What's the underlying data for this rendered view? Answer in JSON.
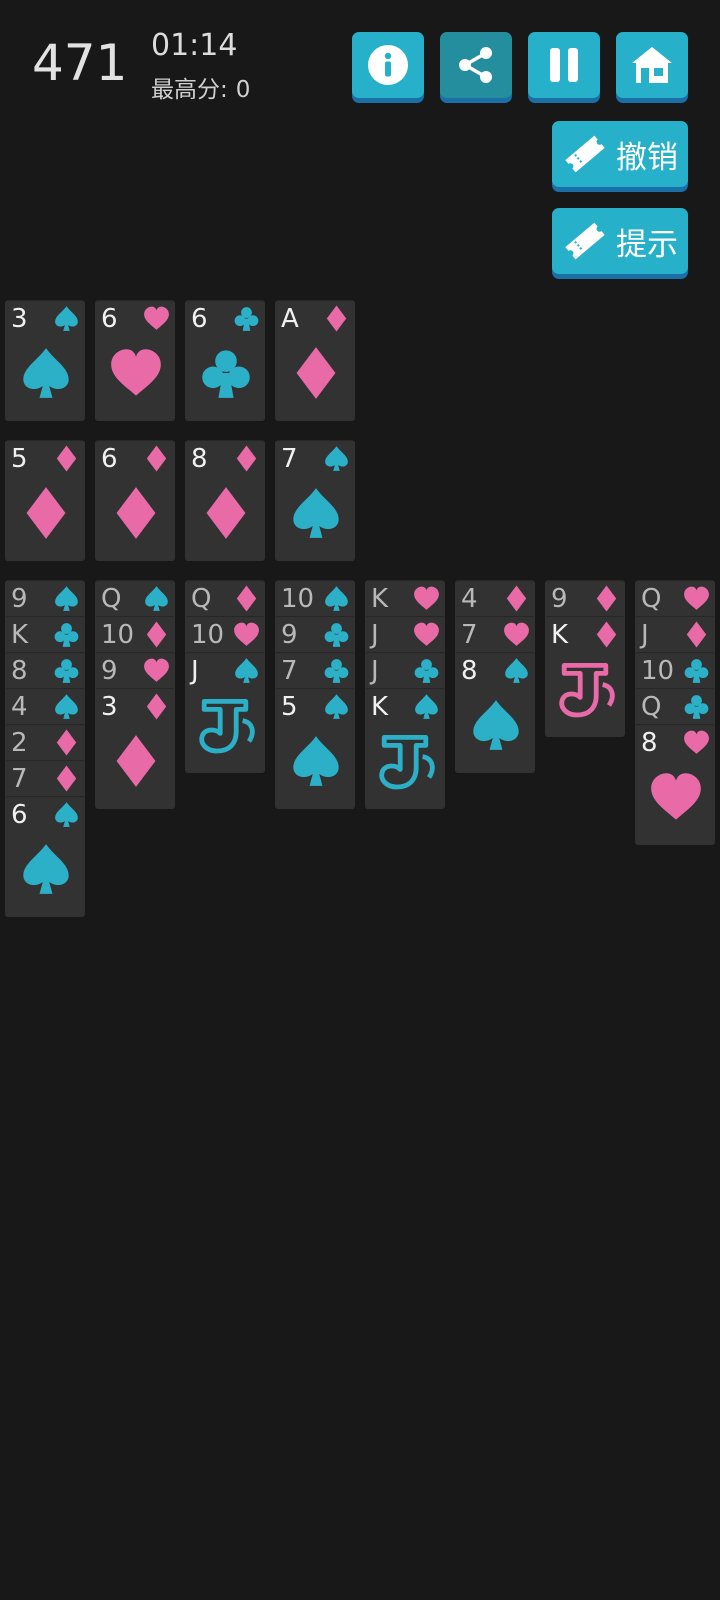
{
  "header": {
    "score": "471",
    "timer": "01:14",
    "best_label": "最高分:",
    "best_value": "0"
  },
  "top_buttons": [
    {
      "name": "info-button",
      "icon": "info"
    },
    {
      "name": "share-button",
      "icon": "share"
    },
    {
      "name": "pause-button",
      "icon": "pause"
    },
    {
      "name": "home-button",
      "icon": "home"
    }
  ],
  "actions": {
    "undo_label": "撤销",
    "hint_label": "提示"
  },
  "colors": {
    "background": "#181818",
    "card": "#323232",
    "black_suit": "#2cb0c8",
    "red_suit": "#e86aa7",
    "button": "#27b0c9",
    "button_shadow": "#1a6fa7"
  },
  "foundations_row1": [
    {
      "rank": "3",
      "suit": "spade"
    },
    {
      "rank": "6",
      "suit": "heart"
    },
    {
      "rank": "6",
      "suit": "club"
    },
    {
      "rank": "A",
      "suit": "diamond"
    }
  ],
  "foundations_row2": [
    {
      "rank": "5",
      "suit": "diamond"
    },
    {
      "rank": "6",
      "suit": "diamond"
    },
    {
      "rank": "8",
      "suit": "diamond"
    },
    {
      "rank": "7",
      "suit": "spade"
    }
  ],
  "tableau": [
    [
      {
        "rank": "9",
        "suit": "spade"
      },
      {
        "rank": "K",
        "suit": "club"
      },
      {
        "rank": "8",
        "suit": "club"
      },
      {
        "rank": "4",
        "suit": "spade"
      },
      {
        "rank": "2",
        "suit": "diamond"
      },
      {
        "rank": "7",
        "suit": "diamond"
      },
      {
        "rank": "6",
        "suit": "spade"
      }
    ],
    [
      {
        "rank": "Q",
        "suit": "spade"
      },
      {
        "rank": "10",
        "suit": "diamond"
      },
      {
        "rank": "9",
        "suit": "heart"
      },
      {
        "rank": "3",
        "suit": "diamond"
      }
    ],
    [
      {
        "rank": "Q",
        "suit": "diamond"
      },
      {
        "rank": "10",
        "suit": "heart"
      },
      {
        "rank": "J",
        "suit": "spade"
      }
    ],
    [
      {
        "rank": "10",
        "suit": "spade"
      },
      {
        "rank": "9",
        "suit": "club"
      },
      {
        "rank": "7",
        "suit": "club"
      },
      {
        "rank": "5",
        "suit": "spade"
      }
    ],
    [
      {
        "rank": "K",
        "suit": "heart"
      },
      {
        "rank": "J",
        "suit": "heart"
      },
      {
        "rank": "J",
        "suit": "club"
      },
      {
        "rank": "K",
        "suit": "spade"
      }
    ],
    [
      {
        "rank": "4",
        "suit": "diamond"
      },
      {
        "rank": "7",
        "suit": "heart"
      },
      {
        "rank": "8",
        "suit": "spade"
      }
    ],
    [
      {
        "rank": "9",
        "suit": "diamond"
      },
      {
        "rank": "K",
        "suit": "diamond"
      }
    ],
    [
      {
        "rank": "Q",
        "suit": "heart"
      },
      {
        "rank": "J",
        "suit": "diamond"
      },
      {
        "rank": "10",
        "suit": "club"
      },
      {
        "rank": "Q",
        "suit": "club"
      },
      {
        "rank": "8",
        "suit": "heart"
      }
    ]
  ]
}
